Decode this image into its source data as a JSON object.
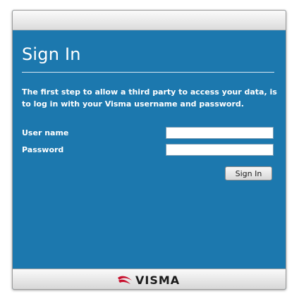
{
  "dialog": {
    "title": "Sign In",
    "intro": "The first step to allow a third party to access your data, is to log in with your Visma username and password."
  },
  "form": {
    "username_label": "User name",
    "username_value": "",
    "password_label": "Password",
    "password_value": "",
    "submit_label": "Sign In"
  },
  "footer": {
    "logo_icon": "visma-swoosh-icon",
    "logo_text": "VISMA"
  },
  "colors": {
    "panel_background": "#1c78ae",
    "logo_accent": "#c8102e"
  }
}
